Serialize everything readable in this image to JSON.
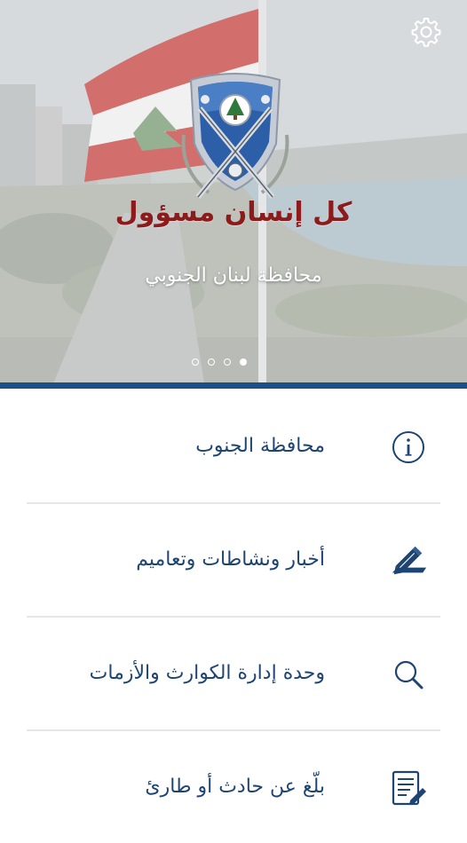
{
  "hero": {
    "slogan": "كل إنسان مسؤول",
    "province": "محافظة لبنان الجنوبي",
    "slides": 4,
    "active_slide": 4
  },
  "icons": {
    "settings": "gear-icon",
    "info": "info-icon",
    "news": "pen-icon",
    "crisis": "search-icon",
    "report": "report-form-icon"
  },
  "colors": {
    "accent_bar": "#1b4f86",
    "menu_text": "#1d4473",
    "slogan": "#8e1b1b"
  },
  "menu": {
    "items": [
      {
        "label": "محافظة الجنوب",
        "icon": "info-icon"
      },
      {
        "label": "أخبار ونشاطات وتعاميم",
        "icon": "pen-icon"
      },
      {
        "label": "وحدة إدارة الكوارث والأزمات",
        "icon": "search-icon"
      },
      {
        "label": "بلّغ عن حادث أو طارئ",
        "icon": "report-form-icon"
      }
    ]
  }
}
